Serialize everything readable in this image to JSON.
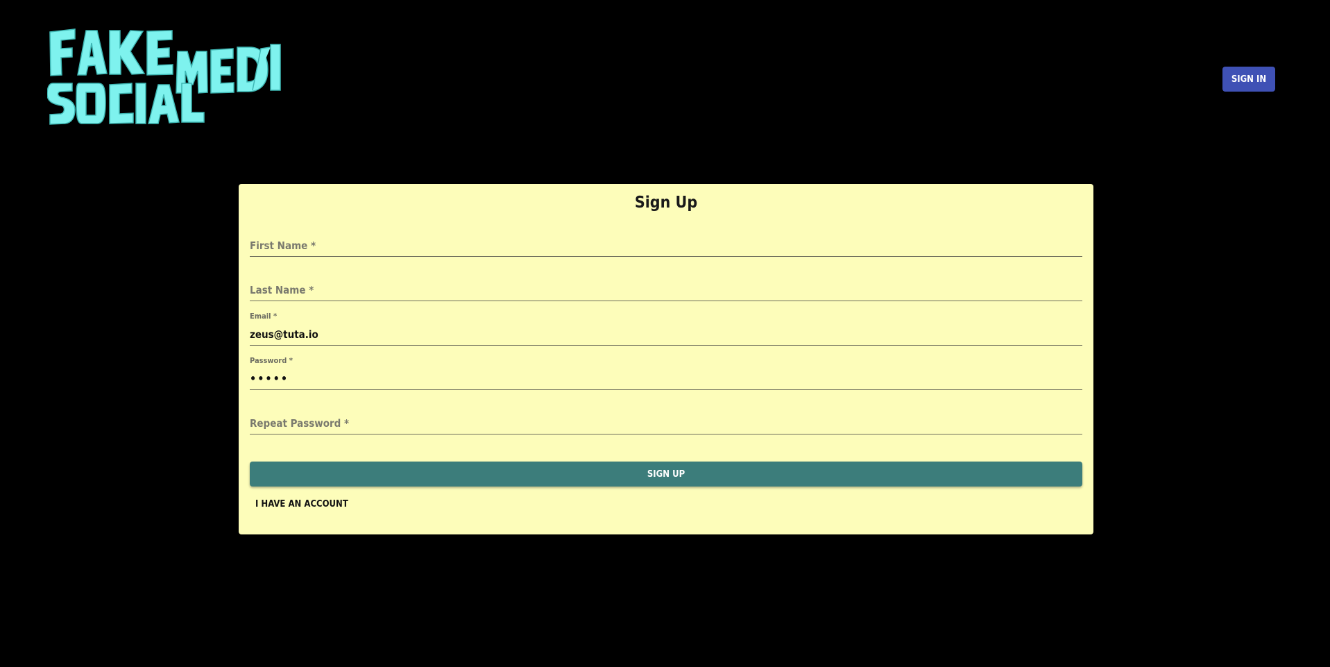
{
  "header": {
    "logo_text": "FAKE SOCIAL MEDIA",
    "logo_color": "#7ef2ee",
    "signin_label": "SIGN IN",
    "signin_color": "#3f51b5"
  },
  "card": {
    "title": "Sign Up",
    "background": "#fdfdba",
    "fields": [
      {
        "label": "First Name *",
        "value": "",
        "state": "empty"
      },
      {
        "label": "Last Name *",
        "value": "",
        "state": "empty"
      },
      {
        "label": "Email *",
        "value": "zeus@tuta.io",
        "state": "filled"
      },
      {
        "label": "Password *",
        "value": "•••••",
        "state": "filled"
      },
      {
        "label": "Repeat Password *",
        "value": "",
        "state": "empty"
      }
    ],
    "signup_label": "SIGN UP",
    "signup_color": "#3c7d7b",
    "account_link_label": "I HAVE AN ACCOUNT"
  }
}
